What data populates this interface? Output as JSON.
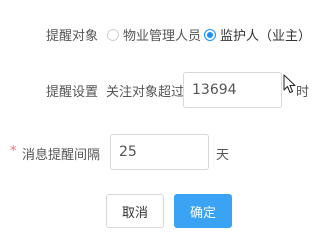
{
  "form": {
    "target_label": "提醒对象",
    "target_options": [
      {
        "label": "物业管理人员",
        "checked": false
      },
      {
        "label": "监护人（业主）",
        "checked": true
      }
    ],
    "setting_label": "提醒设置",
    "setting_prefix": "关注对象超过",
    "setting_value": "13694",
    "setting_unit": "时",
    "interval_required_mark": "*",
    "interval_label": "消息提醒间隔",
    "interval_value": "25",
    "interval_unit": "天"
  },
  "buttons": {
    "cancel": "取消",
    "confirm": "确定"
  },
  "colors": {
    "primary": "#3aa3f3",
    "required": "#f56c6c"
  },
  "icons": [
    "mouse-cursor-icon"
  ]
}
